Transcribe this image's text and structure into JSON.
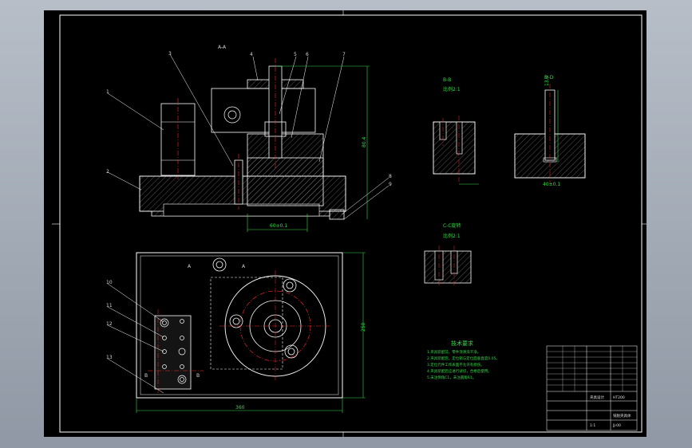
{
  "views": {
    "section_aa": {
      "label": "A-A",
      "dim_height": "80.4",
      "dim_width": "60±0.1"
    },
    "section_bb": {
      "label": "B-B",
      "scale": "比例2:1"
    },
    "section_dd": {
      "label": "D-D",
      "dim_height": "13.4",
      "dim_bottom": "40±0.1"
    },
    "section_cc": {
      "label": "C-C旋转",
      "scale": "比例2:1"
    },
    "plan_view": {
      "dim_width": "360",
      "dim_height": "250",
      "marker_a_left": "A",
      "marker_a_right": "A",
      "marker_b_left": "B",
      "marker_b_right": "B"
    }
  },
  "tech_req": {
    "title": "技术要求",
    "lines": [
      "1.夹具装配前，零件须清洗干净。",
      "2.夹具装配后，定位销与定位面垂直度0.05。",
      "3.定位元件工作表面不允许有损伤。",
      "4.夹具装配后应进行试切，合格后使用。",
      "5.未注倒角C1，未注圆角R1。"
    ]
  },
  "title_block": {
    "company": "夹具设计",
    "part_name": "铣削夹具体",
    "drawing_no": "JJ-00",
    "material": "HT200",
    "scale": "1:1"
  },
  "colors": {
    "line": "#ffffff",
    "hidden": "#ff2a2a",
    "dim": "#39d94a",
    "hatch": "#a0a0a0",
    "fill": "#1b1b1b"
  }
}
